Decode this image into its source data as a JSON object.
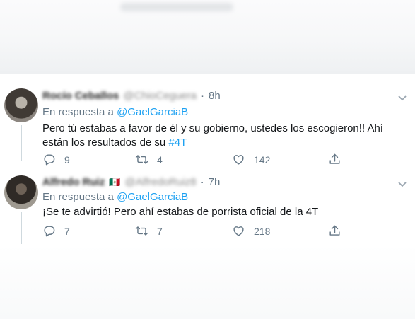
{
  "tweets": [
    {
      "author_name": "Rocío Ceballos",
      "handle": "@ChioCeguera",
      "time": "8h",
      "reply_prefix": "En respuesta a",
      "reply_mention": "@GaelGarciaB",
      "text_before": "Pero tú estabas a favor de él y su gobierno, ustedes los escogieron!! Ahí están los resultados de su ",
      "hashtag": "#4T",
      "replies": "9",
      "retweets": "4",
      "likes": "142"
    },
    {
      "author_name": "Alfredo Ruiz",
      "flag": "🇲🇽",
      "handle": "@AlfredoRuiz8",
      "time": "7h",
      "reply_prefix": "En respuesta a",
      "reply_mention": "@GaelGarciaB",
      "text": "¡Se te advirtió! Pero ahí estabas de porrista oficial de la 4T",
      "replies": "7",
      "retweets": "7",
      "likes": "218"
    }
  ],
  "icons": {
    "reply": "reply-icon",
    "retweet": "retweet-icon",
    "like": "heart-icon",
    "share": "share-icon",
    "more": "chevron-down-icon"
  },
  "colors": {
    "link": "#1da1f2",
    "muted": "#657786",
    "text": "#14171a"
  }
}
